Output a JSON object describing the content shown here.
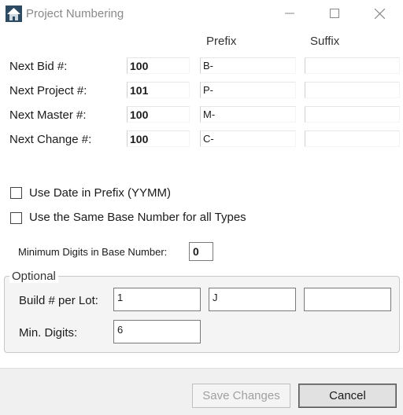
{
  "window": {
    "title": "Project Numbering",
    "icon": "app-house-icon",
    "controls": [
      "minimize-icon",
      "maximize-icon",
      "close-icon"
    ]
  },
  "columns": {
    "prefix": "Prefix",
    "suffix": "Suffix"
  },
  "rows": [
    {
      "label": "Next Bid #:",
      "number": "100",
      "prefix": "B-",
      "suffix": ""
    },
    {
      "label": "Next Project #:",
      "number": "101",
      "prefix": "P-",
      "suffix": ""
    },
    {
      "label": "Next Master #:",
      "number": "100",
      "prefix": "M-",
      "suffix": ""
    },
    {
      "label": "Next Change #:",
      "number": "100",
      "prefix": "C-",
      "suffix": ""
    }
  ],
  "options": {
    "use_date_label": "Use Date in Prefix (YYMM)",
    "use_date_checked": false,
    "same_base_label": "Use the Same Base Number for all Types",
    "same_base_checked": false,
    "min_digits_label": "Minimum Digits in Base Number:",
    "min_digits_value": "0"
  },
  "optional": {
    "legend": "Optional",
    "build_label": "Build # per Lot:",
    "build_value": "1",
    "build_prefix": "J",
    "build_suffix": "",
    "min_digits_label": "Min. Digits:",
    "min_digits_value": "6"
  },
  "buttons": {
    "save": "Save Changes",
    "cancel": "Cancel"
  },
  "colors": {
    "disabled_text": "#a0a0a0",
    "footer_bg": "#f0f0f0"
  }
}
